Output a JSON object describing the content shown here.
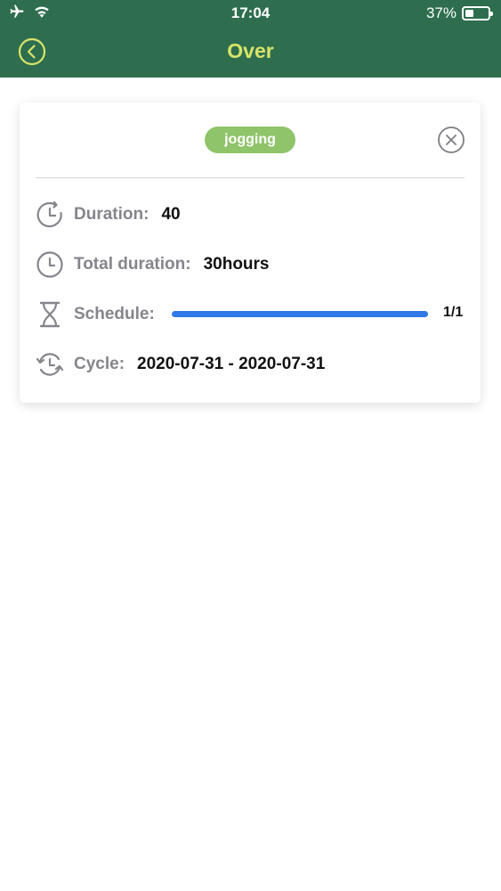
{
  "status_bar": {
    "time": "17:04",
    "battery_percent": "37%",
    "battery_level": 0.37,
    "icons": [
      "airplane-icon",
      "wifi-icon",
      "battery-icon"
    ]
  },
  "nav": {
    "title": "Over",
    "back_icon": "chevron-left-circle-icon",
    "title_color": "#d8e46a",
    "bar_color": "#2e6e4f"
  },
  "card": {
    "tag": "jogging",
    "tag_color": "#8fc46a",
    "close_icon": "close-circle-icon",
    "rows": [
      {
        "icon": "clock-rotate-icon",
        "label": "Duration:",
        "value": "40"
      },
      {
        "icon": "clock-icon",
        "label": "Total duration:",
        "value": "30hours"
      },
      {
        "icon": "hourglass-icon",
        "label": "Schedule:",
        "progress_text": "1/1",
        "progress_fraction": 1.0,
        "progress_color": "#2f7ae8"
      },
      {
        "icon": "cycle-icon",
        "label": "Cycle:",
        "value": "2020-07-31 - 2020-07-31"
      }
    ]
  }
}
